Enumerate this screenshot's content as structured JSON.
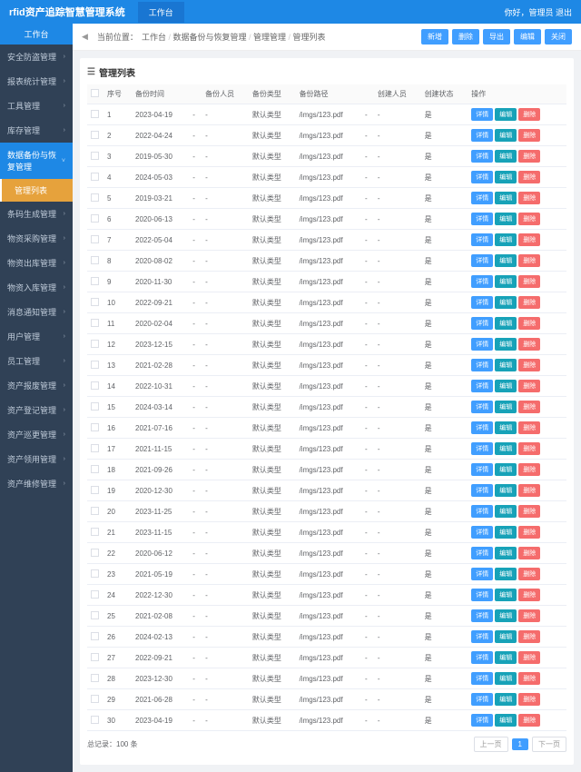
{
  "header": {
    "logo": "rfid资产追踪智慧管理系统",
    "tab": "工作台",
    "greeting": "你好，管理员 退出"
  },
  "sidebar": {
    "top": "工作台",
    "items": [
      {
        "label": "安全防盗管理",
        "open": false
      },
      {
        "label": "报表统计管理",
        "open": false
      },
      {
        "label": "工具管理",
        "open": false
      },
      {
        "label": "库存管理",
        "open": false
      },
      {
        "label": "数据备份与恢复管理",
        "open": true,
        "sub": "管理列表"
      },
      {
        "label": "条码生成管理",
        "open": false
      },
      {
        "label": "物资采购管理",
        "open": false
      },
      {
        "label": "物资出库管理",
        "open": false
      },
      {
        "label": "物资入库管理",
        "open": false
      },
      {
        "label": "消息通知管理",
        "open": false
      },
      {
        "label": "用户管理",
        "open": false
      },
      {
        "label": "员工管理",
        "open": false
      },
      {
        "label": "资产报废管理",
        "open": false
      },
      {
        "label": "资产登记管理",
        "open": false
      },
      {
        "label": "资产巡更管理",
        "open": false
      },
      {
        "label": "资产领用管理",
        "open": false
      },
      {
        "label": "资产维修管理",
        "open": false
      }
    ]
  },
  "breadcrumb": {
    "label": "当前位置：",
    "parts": [
      "工作台",
      "数据备份与恢复管理",
      "管理管理",
      "管理列表"
    ]
  },
  "topActions": [
    "新增",
    "删除",
    "导出",
    "编辑",
    "关闭"
  ],
  "panel": {
    "title": "管理列表"
  },
  "columns": [
    "",
    "序号",
    "备份时间",
    "",
    "备份人员",
    "备份类型",
    "备份路径",
    "",
    "创建人员",
    "创建状态",
    "操作"
  ],
  "rowActions": [
    "详情",
    "编辑",
    "删除"
  ],
  "rows": [
    {
      "n": 1,
      "d": "2023-04-19",
      "t": "默认类型",
      "p": "/imgs/123.pdf",
      "s": "是"
    },
    {
      "n": 2,
      "d": "2022-04-24",
      "t": "默认类型",
      "p": "/imgs/123.pdf",
      "s": "是"
    },
    {
      "n": 3,
      "d": "2019-05-30",
      "t": "默认类型",
      "p": "/imgs/123.pdf",
      "s": "是"
    },
    {
      "n": 4,
      "d": "2024-05-03",
      "t": "默认类型",
      "p": "/imgs/123.pdf",
      "s": "是"
    },
    {
      "n": 5,
      "d": "2019-03-21",
      "t": "默认类型",
      "p": "/imgs/123.pdf",
      "s": "是"
    },
    {
      "n": 6,
      "d": "2020-06-13",
      "t": "默认类型",
      "p": "/imgs/123.pdf",
      "s": "是"
    },
    {
      "n": 7,
      "d": "2022-05-04",
      "t": "默认类型",
      "p": "/imgs/123.pdf",
      "s": "是"
    },
    {
      "n": 8,
      "d": "2020-08-02",
      "t": "默认类型",
      "p": "/imgs/123.pdf",
      "s": "是"
    },
    {
      "n": 9,
      "d": "2020-11-30",
      "t": "默认类型",
      "p": "/imgs/123.pdf",
      "s": "是"
    },
    {
      "n": 10,
      "d": "2022-09-21",
      "t": "默认类型",
      "p": "/imgs/123.pdf",
      "s": "是"
    },
    {
      "n": 11,
      "d": "2020-02-04",
      "t": "默认类型",
      "p": "/imgs/123.pdf",
      "s": "是"
    },
    {
      "n": 12,
      "d": "2023-12-15",
      "t": "默认类型",
      "p": "/imgs/123.pdf",
      "s": "是"
    },
    {
      "n": 13,
      "d": "2021-02-28",
      "t": "默认类型",
      "p": "/imgs/123.pdf",
      "s": "是"
    },
    {
      "n": 14,
      "d": "2022-10-31",
      "t": "默认类型",
      "p": "/imgs/123.pdf",
      "s": "是"
    },
    {
      "n": 15,
      "d": "2024-03-14",
      "t": "默认类型",
      "p": "/imgs/123.pdf",
      "s": "是"
    },
    {
      "n": 16,
      "d": "2021-07-16",
      "t": "默认类型",
      "p": "/imgs/123.pdf",
      "s": "是"
    },
    {
      "n": 17,
      "d": "2021-11-15",
      "t": "默认类型",
      "p": "/imgs/123.pdf",
      "s": "是"
    },
    {
      "n": 18,
      "d": "2021-09-26",
      "t": "默认类型",
      "p": "/imgs/123.pdf",
      "s": "是"
    },
    {
      "n": 19,
      "d": "2020-12-30",
      "t": "默认类型",
      "p": "/imgs/123.pdf",
      "s": "是"
    },
    {
      "n": 20,
      "d": "2023-11-25",
      "t": "默认类型",
      "p": "/imgs/123.pdf",
      "s": "是"
    },
    {
      "n": 21,
      "d": "2023-11-15",
      "t": "默认类型",
      "p": "/imgs/123.pdf",
      "s": "是"
    },
    {
      "n": 22,
      "d": "2020-06-12",
      "t": "默认类型",
      "p": "/imgs/123.pdf",
      "s": "是"
    },
    {
      "n": 23,
      "d": "2021-05-19",
      "t": "默认类型",
      "p": "/imgs/123.pdf",
      "s": "是"
    },
    {
      "n": 24,
      "d": "2022-12-30",
      "t": "默认类型",
      "p": "/imgs/123.pdf",
      "s": "是"
    },
    {
      "n": 25,
      "d": "2021-02-08",
      "t": "默认类型",
      "p": "/imgs/123.pdf",
      "s": "是"
    },
    {
      "n": 26,
      "d": "2024-02-13",
      "t": "默认类型",
      "p": "/imgs/123.pdf",
      "s": "是"
    },
    {
      "n": 27,
      "d": "2022-09-21",
      "t": "默认类型",
      "p": "/imgs/123.pdf",
      "s": "是"
    },
    {
      "n": 28,
      "d": "2023-12-30",
      "t": "默认类型",
      "p": "/imgs/123.pdf",
      "s": "是"
    },
    {
      "n": 29,
      "d": "2021-06-28",
      "t": "默认类型",
      "p": "/imgs/123.pdf",
      "s": "是"
    },
    {
      "n": 30,
      "d": "2023-04-19",
      "t": "默认类型",
      "p": "/imgs/123.pdf",
      "s": "是"
    }
  ],
  "pager": {
    "total": "总记录：100 条",
    "prev": "上一页",
    "cur": "1",
    "next": "下一页"
  }
}
